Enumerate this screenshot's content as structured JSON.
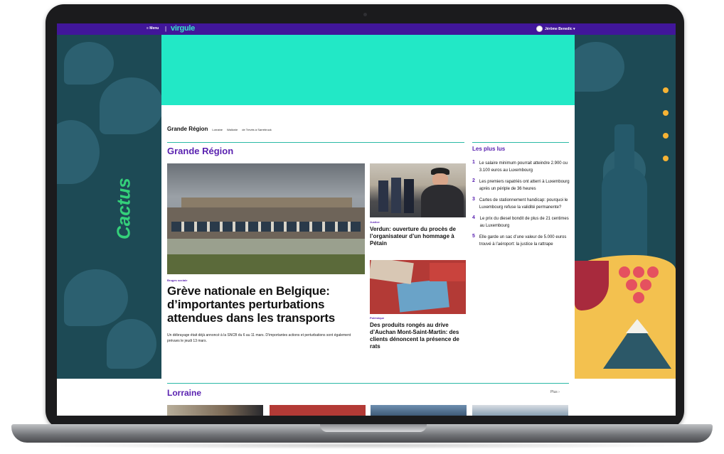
{
  "topbar": {
    "menu_label": "≡ Menu",
    "separator": "|",
    "brand": "virgule",
    "user_name": "Jérôme Benedic ▾"
  },
  "ads": {
    "left_brand": "Cactus"
  },
  "subnav": {
    "title": "Grande Région",
    "items": [
      "Lorraine",
      "Wallonie",
      "de Trevès à Sarrebruck"
    ]
  },
  "section": {
    "title": "Grande Région"
  },
  "hero": {
    "tag": "Bruges sociale",
    "title": "Grève nationale en Belgique: d’importantes perturbations attendues dans les transports",
    "lead": "Un débrayage était déjà annoncé à la SNCB du 6 au 11 mars. D’importantes actions et perturbations sont également prévues le jeudi 13 mars."
  },
  "cards": [
    {
      "tag": "Justice",
      "title": "Verdun: ouverture du procès de l’organisateur d’un hommage à Pétain"
    },
    {
      "tag": "Polémique",
      "title": "Des produits rongés au drive d’Auchan Mont-Saint-Martin: des clients dénoncent la présence de rats"
    }
  ],
  "most_read": {
    "title": "Les plus lus",
    "items": [
      {
        "num": "1",
        "text": "Le salaire minimum pourrait atteindre 2.900 ou 3.100 euros au Luxembourg"
      },
      {
        "num": "2",
        "text": "Les premiers rapatriés ont atterri à Luxembourg après un périple de 36 heures"
      },
      {
        "num": "3",
        "text": "Cartes de stationnement handicap: pourquoi le Luxembourg refuse la validité permanente?"
      },
      {
        "num": "4",
        "text": "Le prix du diesel bondit de plus de 21 centimes au Luxembourg"
      },
      {
        "num": "5",
        "text": "Elle garde un sac d’une valeur de 5.000 euros trouvé à l’aéroport: la justice la rattrape"
      }
    ]
  },
  "lorraine": {
    "title": "Lorraine",
    "more": "Plus ›"
  },
  "colors": {
    "brand_purple": "#41169a",
    "accent_purple": "#5a22b0",
    "teal": "#22e8c6",
    "ad_green": "#1d4a55"
  }
}
